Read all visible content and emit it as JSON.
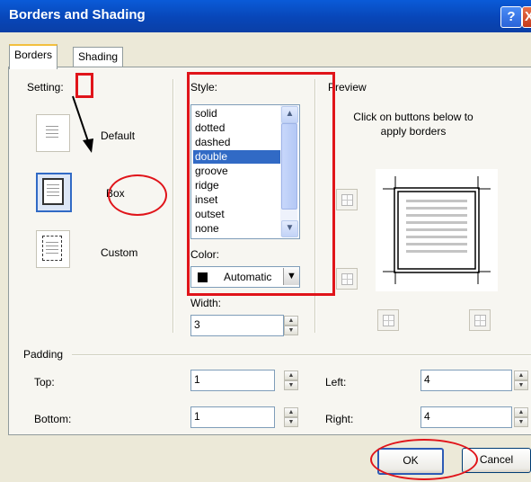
{
  "window": {
    "title": "Borders and Shading",
    "help_glyph": "?",
    "close_glyph": "X"
  },
  "tabs": [
    {
      "label": "Borders",
      "active": true
    },
    {
      "label": "Shading",
      "active": false
    }
  ],
  "setting": {
    "heading": "Setting:",
    "options": [
      {
        "label": "Default",
        "icon": "default-page-icon"
      },
      {
        "label": "Box",
        "icon": "box-page-icon",
        "selected": true
      },
      {
        "label": "Custom",
        "icon": "custom-page-icon"
      }
    ]
  },
  "style": {
    "heading": "Style:",
    "items": [
      "solid",
      "dotted",
      "dashed",
      "double",
      "groove",
      "ridge",
      "inset",
      "outset",
      "none"
    ],
    "selected": "double"
  },
  "color": {
    "heading": "Color:",
    "value": "Automatic",
    "swatch": "#000000"
  },
  "width": {
    "heading": "Width:",
    "value": "3"
  },
  "preview": {
    "heading": "Preview",
    "instructions": "Click on buttons below to apply borders"
  },
  "padding": {
    "heading": "Padding",
    "top_label": "Top:",
    "top_value": "1",
    "bottom_label": "Bottom:",
    "bottom_value": "1",
    "left_label": "Left:",
    "left_value": "4",
    "right_label": "Right:",
    "right_value": "4"
  },
  "buttons": {
    "ok": "OK",
    "cancel": "Cancel"
  },
  "annotations": {
    "color": "#e0141a"
  }
}
